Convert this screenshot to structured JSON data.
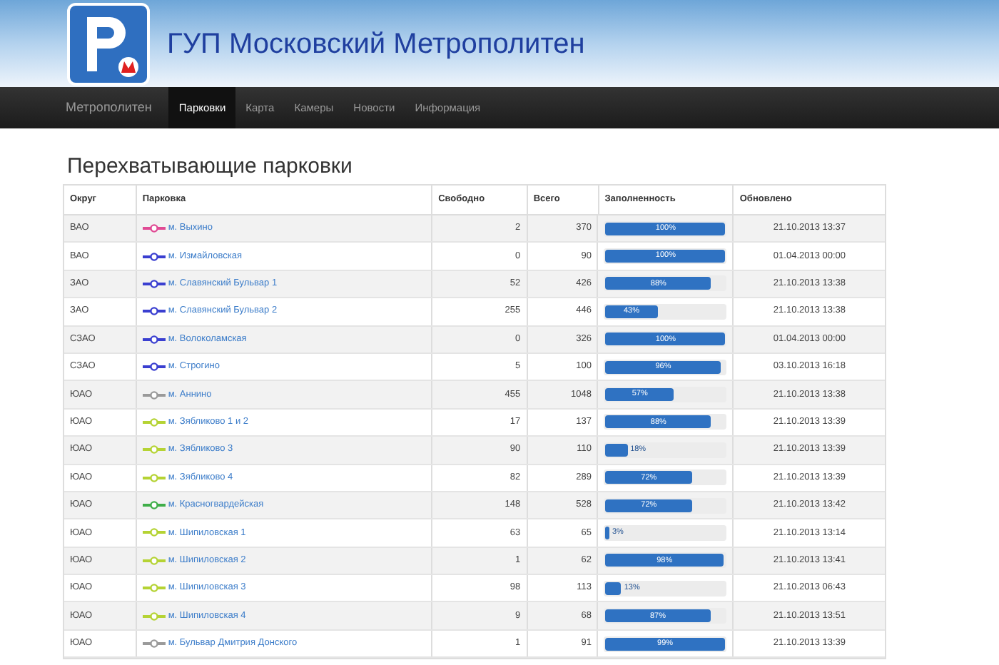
{
  "header": {
    "title": "ГУП Московский Метрополитен"
  },
  "nav": {
    "brand": "Метрополитен",
    "items": [
      {
        "label": "Парковки",
        "selected": true
      },
      {
        "label": "Карта",
        "selected": false
      },
      {
        "label": "Камеры",
        "selected": false
      },
      {
        "label": "Новости",
        "selected": false
      },
      {
        "label": "Информация",
        "selected": false
      }
    ]
  },
  "page_title": "Перехватывающие парковки",
  "table": {
    "columns": [
      "Округ",
      "Парковка",
      "Свободно",
      "Всего",
      "Заполненность",
      "Обновлено"
    ],
    "rows": [
      {
        "district": "ВАО",
        "parking": "м. Выхино",
        "color": "#e04a94",
        "free": "2",
        "total": "370",
        "level": 1,
        "fill": "100%",
        "updated": "21.10.2013 13:37"
      },
      {
        "district": "ВАО",
        "parking": "м. Измайловская",
        "color": "#3a3fd0",
        "free": "0",
        "total": "90",
        "level": 1,
        "fill": "100%",
        "updated": "01.04.2013 00:00"
      },
      {
        "district": "ЗАО",
        "parking": "м. Славянский Бульвар 1",
        "color": "#3a3fd0",
        "free": "52",
        "total": "426",
        "level": 0.88,
        "fill": "88%",
        "updated": "21.10.2013 13:38"
      },
      {
        "district": "ЗАО",
        "parking": "м. Славянский Бульвар 2",
        "color": "#3a3fd0",
        "free": "255",
        "total": "446",
        "level": 0.43,
        "fill": "43%",
        "updated": "21.10.2013 13:38"
      },
      {
        "district": "СЗАО",
        "parking": "м. Волоколамская",
        "color": "#3a3fd0",
        "free": "0",
        "total": "326",
        "level": 1,
        "fill": "100%",
        "updated": "01.04.2013 00:00"
      },
      {
        "district": "СЗАО",
        "parking": "м. Строгино",
        "color": "#3a3fd0",
        "free": "5",
        "total": "100",
        "level": 0.96,
        "fill": "96%",
        "updated": "03.10.2013 16:18"
      },
      {
        "district": "ЮАО",
        "parking": "м. Аннино",
        "color": "#9a9a9a",
        "free": "455",
        "total": "1048",
        "level": 0.57,
        "fill": "57%",
        "updated": "21.10.2013 13:38"
      },
      {
        "district": "ЮАО",
        "parking": "м. Зябликово 1 и 2",
        "color": "#b5d334",
        "free": "17",
        "total": "137",
        "level": 0.88,
        "fill": "88%",
        "updated": "21.10.2013 13:39"
      },
      {
        "district": "ЮАО",
        "parking": "м. Зябликово 3",
        "color": "#b5d334",
        "free": "90",
        "total": "110",
        "level": 0.18,
        "fill": "18%",
        "updated": "21.10.2013 13:39"
      },
      {
        "district": "ЮАО",
        "parking": "м. Зябликово 4",
        "color": "#b5d334",
        "free": "82",
        "total": "289",
        "level": 0.72,
        "fill": "72%",
        "updated": "21.10.2013 13:39"
      },
      {
        "district": "ЮАО",
        "parking": "м. Красногвардейская",
        "color": "#3fae49",
        "free": "148",
        "total": "528",
        "level": 0.72,
        "fill": "72%",
        "updated": "21.10.2013 13:42"
      },
      {
        "district": "ЮАО",
        "parking": "м. Шипиловская 1",
        "color": "#b5d334",
        "free": "63",
        "total": "65",
        "level": 0.03,
        "fill": "3%",
        "updated": "21.10.2013 13:14"
      },
      {
        "district": "ЮАО",
        "parking": "м. Шипиловская 2",
        "color": "#b5d334",
        "free": "1",
        "total": "62",
        "level": 0.98,
        "fill": "98%",
        "updated": "21.10.2013 13:41"
      },
      {
        "district": "ЮАО",
        "parking": "м. Шипиловская 3",
        "color": "#b5d334",
        "free": "98",
        "total": "113",
        "level": 0.13,
        "fill": "13%",
        "updated": "21.10.2013 06:43"
      },
      {
        "district": "ЮАО",
        "parking": "м. Шипиловская 4",
        "color": "#b5d334",
        "free": "9",
        "total": "68",
        "level": 0.87,
        "fill": "87%",
        "updated": "21.10.2013 13:51"
      },
      {
        "district": "ЮАО",
        "parking": "м. Бульвар Дмитрия Донского",
        "color": "#9a9a9a",
        "free": "1",
        "total": "91",
        "level": 0.99,
        "fill": "99%",
        "updated": "21.10.2013 13:39"
      }
    ]
  }
}
